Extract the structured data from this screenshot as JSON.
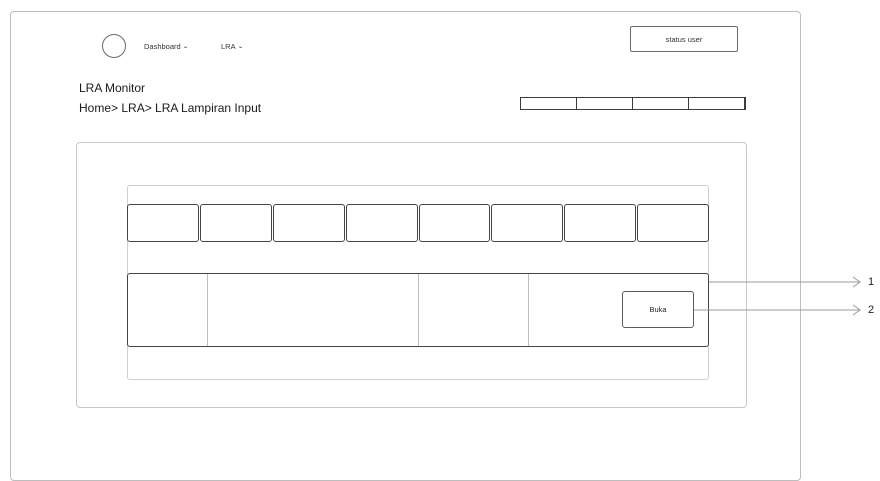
{
  "header": {
    "nav": [
      {
        "label": "Dashboard",
        "icon": "chevron-down-icon"
      },
      {
        "label": "LRA",
        "icon": "chevron-down-icon"
      }
    ],
    "status_button": "status user"
  },
  "page": {
    "title": "LRA Monitor",
    "breadcrumb": "Home> LRA> LRA Lampiran Input"
  },
  "mini_tabs_count": 4,
  "table": {
    "header_cells_count": 8,
    "row": {
      "action_label": "Buka"
    }
  },
  "callouts": [
    "1",
    "2"
  ]
}
